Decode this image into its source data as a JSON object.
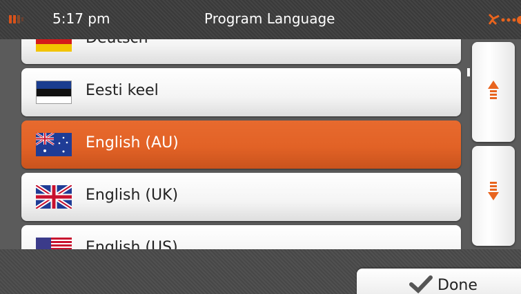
{
  "status_bar": {
    "time": "5:17 pm",
    "title": "Program Language",
    "battery_icon": "battery-icon",
    "gps_icon": "gps-signal-icon",
    "accent_color": "#e26226"
  },
  "languages": [
    {
      "label": "Deutsch",
      "flag": "flag-germany-icon",
      "selected": false
    },
    {
      "label": "Eesti keel",
      "flag": "flag-estonia-icon",
      "selected": false
    },
    {
      "label": "English (AU)",
      "flag": "flag-australia-icon",
      "selected": true
    },
    {
      "label": "English (UK)",
      "flag": "flag-uk-icon",
      "selected": false
    },
    {
      "label": "English (US)",
      "flag": "flag-us-icon",
      "selected": false
    }
  ],
  "scroll": {
    "up_icon": "scroll-up-arrow-icon",
    "down_icon": "scroll-down-arrow-icon"
  },
  "footer": {
    "done_label": "Done",
    "done_icon": "checkmark-icon"
  }
}
